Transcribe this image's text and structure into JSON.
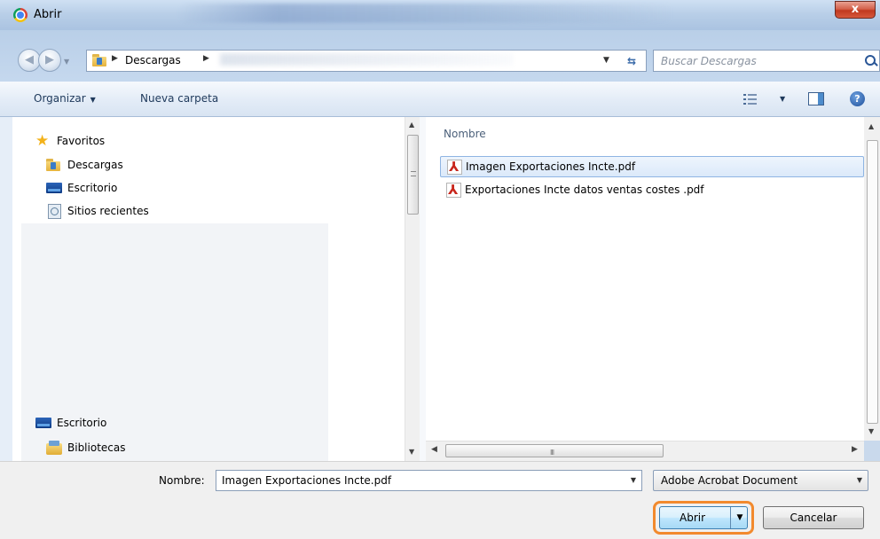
{
  "window": {
    "title": "Abrir",
    "close_glyph": "x"
  },
  "address": {
    "crumbs": [
      "Descargas"
    ],
    "search_placeholder": "Buscar Descargas"
  },
  "toolbar": {
    "organize_label": "Organizar",
    "new_folder_label": "Nueva carpeta",
    "help_glyph": "?"
  },
  "sidebar": {
    "favorites": {
      "label": "Favoritos",
      "icon": "star-icon"
    },
    "favorite_items": [
      {
        "label": "Descargas",
        "icon": "downloads-folder-icon"
      },
      {
        "label": "Escritorio",
        "icon": "desktop-icon"
      },
      {
        "label": "Sitios recientes",
        "icon": "recent-places-icon"
      }
    ],
    "bottom_items": [
      {
        "label": "Escritorio",
        "icon": "desktop-icon"
      },
      {
        "label": "Bibliotecas",
        "icon": "libraries-icon"
      }
    ]
  },
  "files": {
    "column_header": "Nombre",
    "items": [
      {
        "name": "Imagen Exportaciones Incte.pdf",
        "icon": "pdf-icon",
        "selected": true
      },
      {
        "name": "Exportaciones Incte datos ventas costes .pdf",
        "icon": "pdf-icon",
        "selected": false
      }
    ],
    "hscroll_grip": "III"
  },
  "footer": {
    "name_label": "Nombre:",
    "name_value": "Imagen Exportaciones Incte.pdf",
    "file_type": "Adobe Acrobat Document",
    "open_label": "Abrir",
    "cancel_label": "Cancelar",
    "highlight_color": "#f28a2e"
  }
}
